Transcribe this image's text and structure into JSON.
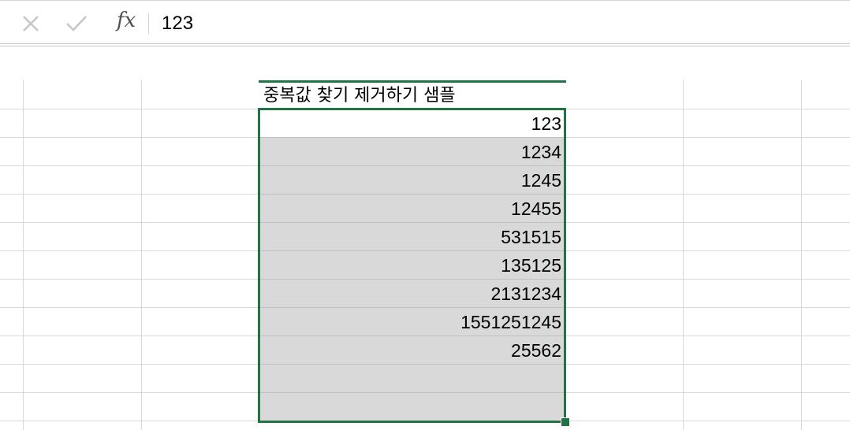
{
  "formula_bar": {
    "cancel_icon": "x-icon",
    "enter_icon": "check-icon",
    "fx_label": "fx",
    "value": "123"
  },
  "sheet": {
    "header_cell": "중복값 찾기 제거하기 샘플",
    "values": [
      "123",
      "1234",
      "1245",
      "12455",
      "531515",
      "135125",
      "2131234",
      "1551251245",
      "25562",
      "",
      ""
    ],
    "accent_color": "#217346",
    "selection_fill": "#d9d9d9"
  }
}
